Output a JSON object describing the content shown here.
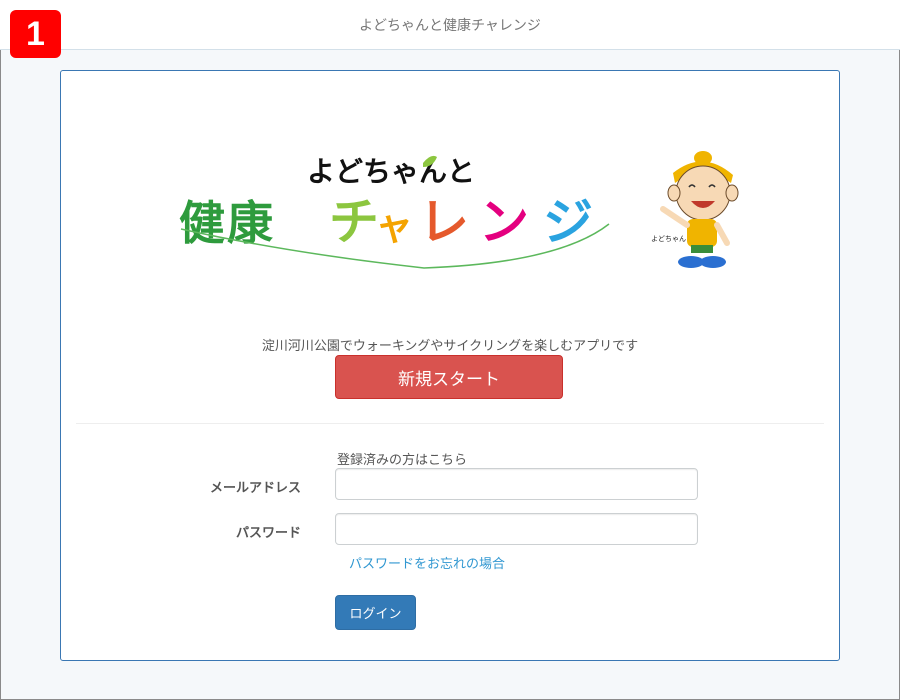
{
  "step_badge": "1",
  "header": {
    "title": "よどちゃんと健康チャレンジ"
  },
  "logo": {
    "line1": "よどちゃんと",
    "line2_chars": [
      "健",
      "康",
      "チ",
      "ャ",
      "レ",
      "ン",
      "ジ"
    ],
    "char_colors": [
      "#2e9b3d",
      "#2e9b3d",
      "#8cc63f",
      "#f4a300",
      "#e5592c",
      "#e4007f",
      "#2aa3e0"
    ]
  },
  "mascot": {
    "name_label": "よどちゃん"
  },
  "intro": {
    "tagline": "淀川河川公園でウォーキングやサイクリングを楽しむアプリです",
    "start_button": "新規スタート"
  },
  "login": {
    "registered_text": "登録済みの方はこちら",
    "email_label": "メールアドレス",
    "email_value": "",
    "password_label": "パスワード",
    "password_value": "",
    "forgot_link": "パスワードをお忘れの場合",
    "login_button": "ログイン"
  },
  "colors": {
    "danger": "#d9534f",
    "primary": "#337ab7",
    "link": "#3097d1"
  }
}
